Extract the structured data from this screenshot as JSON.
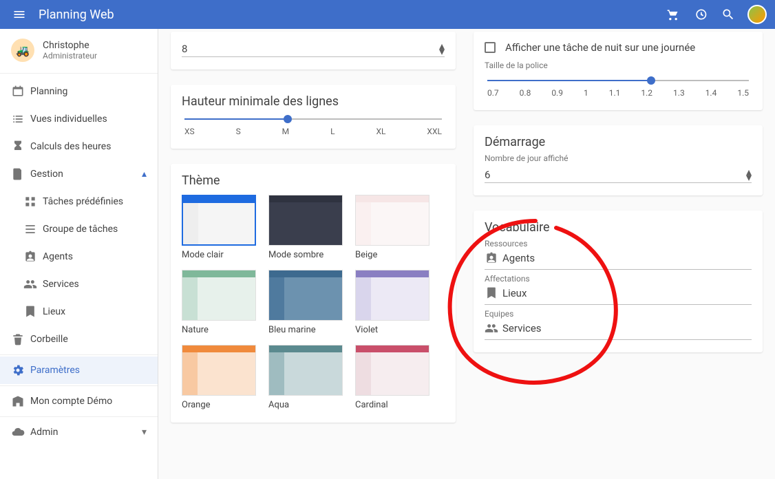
{
  "app": {
    "title": "Planning Web"
  },
  "user": {
    "name": "Christophe",
    "role": "Administrateur"
  },
  "nav": {
    "planning": "Planning",
    "vues": "Vues individuelles",
    "calculs": "Calculs des heures",
    "gestion": {
      "label": "Gestion",
      "expanded": true,
      "taches": "Tâches prédéfinies",
      "groupe": "Groupe de tâches",
      "agents": "Agents",
      "services": "Services",
      "lieux": "Lieux"
    },
    "corbeille": "Corbeille",
    "parametres": "Paramètres",
    "compte": "Mon compte Démo",
    "admin": "Admin"
  },
  "num8": {
    "value": "8"
  },
  "hauteur": {
    "title": "Hauteur minimale des lignes",
    "ticks": [
      "XS",
      "S",
      "M",
      "L",
      "XL",
      "XXL"
    ],
    "value": "M",
    "index": 2,
    "count": 6
  },
  "theme": {
    "title": "Thème",
    "items": [
      {
        "name": "Mode clair",
        "top": "#1e6be0",
        "side": "#eeeeee",
        "body": "#f5f5f5",
        "selected": true
      },
      {
        "name": "Mode sombre",
        "top": "#2f3340",
        "side": "#3a3e4d",
        "body": "#3a3e4d"
      },
      {
        "name": "Beige",
        "top": "#f6e6e6",
        "side": "#faf0f0",
        "body": "#fbf6f6"
      },
      {
        "name": "Nature",
        "top": "#7fb89a",
        "side": "#c8e0d4",
        "body": "#e7f1eb"
      },
      {
        "name": "Bleu marine",
        "top": "#3d6a8f",
        "side": "#4f7a9e",
        "body": "#6c92af"
      },
      {
        "name": "Violet",
        "top": "#8a7fc2",
        "side": "#d9d5ec",
        "body": "#ece9f5"
      },
      {
        "name": "Orange",
        "top": "#f08a3c",
        "side": "#f8c9a2",
        "body": "#fbe3cf"
      },
      {
        "name": "Aqua",
        "top": "#5b8a8f",
        "side": "#9fbcc0",
        "body": "#c9d9db"
      },
      {
        "name": "Cardinal",
        "top": "#c94f6a",
        "side": "#eedde1",
        "body": "#f6edef"
      }
    ]
  },
  "affichage": {
    "check": "Afficher une tâche de nuit sur une journée",
    "police_label": "Taille de la police",
    "police_ticks": [
      "0.7",
      "0.8",
      "0.9",
      "1",
      "1.1",
      "1.2",
      "1.3",
      "1.4",
      "1.5"
    ],
    "police_value": "1.2",
    "police_index": 5,
    "police_count": 9
  },
  "demarrage": {
    "title": "Démarrage",
    "sub": "Nombre de jour affiché",
    "value": "6"
  },
  "vocab": {
    "title": "Vocabulaire",
    "rows": [
      {
        "label": "Ressources",
        "value": "Agents",
        "icon": "badge"
      },
      {
        "label": "Affectations",
        "value": "Lieux",
        "icon": "bookmark"
      },
      {
        "label": "Equipes",
        "value": "Services",
        "icon": "group"
      }
    ]
  }
}
